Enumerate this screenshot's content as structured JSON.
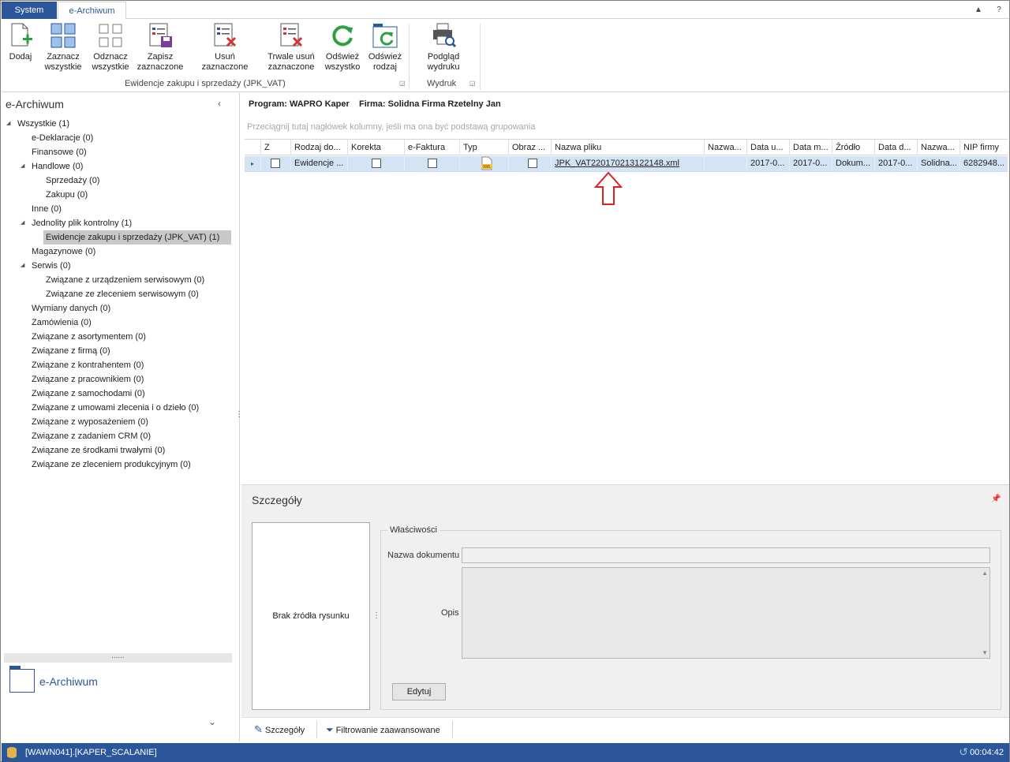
{
  "tabs": {
    "system": "System",
    "earchiwum": "e-Archiwum"
  },
  "ribbon": {
    "buttons": [
      {
        "label": "Dodaj"
      },
      {
        "label": "Zaznacz\nwszystkie"
      },
      {
        "label": "Odznacz\nwszystkie"
      },
      {
        "label": "Zapisz\nzaznaczone"
      },
      {
        "label": "Usuń zaznaczone"
      },
      {
        "label": "Trwale usuń\nzaznaczone"
      },
      {
        "label": "Odśwież\nwszystko"
      },
      {
        "label": "Odśwież\nrodzaj"
      },
      {
        "label": "Podgląd\nwydruku"
      }
    ],
    "group1": "Ewidencje zakupu i sprzedaży (JPK_VAT)",
    "group2": "Wydruk"
  },
  "left": {
    "title": "e-Archiwum",
    "tree": [
      "Wszystkie (1)",
      "e-Deklaracje (0)",
      "Finansowe (0)",
      "Handlowe (0)",
      "Sprzedaży (0)",
      "Zakupu (0)",
      "Inne (0)",
      "Jednolity plik kontrolny (1)",
      "Ewidencje zakupu i sprzedaży (JPK_VAT) (1)",
      "Magazynowe (0)",
      "Serwis (0)",
      "Związane z urządzeniem serwisowym (0)",
      "Związane ze zleceniem serwisowym (0)",
      "Wymiany danych (0)",
      "Zamówienia (0)",
      "Związane z asortymentem (0)",
      "Związane z firmą (0)",
      "Związane z kontrahentem (0)",
      "Związane z pracownikiem (0)",
      "Związane z samochodami (0)",
      "Związane z umowami zlecenia i o dzieło (0)",
      "Związane z wyposażeniem (0)",
      "Związane z zadaniem CRM (0)",
      "Związane ze środkami trwałymi (0)",
      "Związane ze zleceniem produkcyjnym (0)"
    ],
    "divider": "......",
    "nav_label": "e-Archiwum"
  },
  "main": {
    "program_line": "Program: WAPRO Kaper    Firma: Solidna Firma Rzetelny Jan",
    "group_hint": "Przeciągnij tutaj nagłówek kolumny, jeśli ma ona być podstawą grupowania",
    "columns": [
      "Z",
      "Rodzaj do...",
      "Korekta",
      "e-Faktura",
      "Typ",
      "Obraz ...",
      "Nazwa pliku",
      "Nazwa...",
      "Data u...",
      "Data m...",
      "Źródło",
      "Data d...",
      "Nazwa...",
      "NIP firmy"
    ],
    "row": {
      "rodzaj": "Ewidencje ...",
      "typ_icon": "XML",
      "nazwa_pliku": "JPK_VAT220170213122148.xml",
      "data_u": "2017-0...",
      "data_m": "2017-0...",
      "zrodlo": "Dokum...",
      "data_d": "2017-0...",
      "nazwa2": "Solidna...",
      "nip": "6282948..."
    }
  },
  "details": {
    "title": "Szczegóły",
    "no_image": "Brak źródła rysunku",
    "props_legend": "Właściwości",
    "name_label": "Nazwa dokumentu",
    "opis_label": "Opis",
    "edit_button": "Edytuj"
  },
  "bottom_tabs": {
    "details": "Szczegóły",
    "filter": "Filtrowanie zaawansowane"
  },
  "status": {
    "db": "[WAWN041].[KAPER_SCALANIE]",
    "time": "00:04:42"
  },
  "colors": {
    "accent": "#2b579a",
    "row_selected": "#d4e4f5",
    "arrow": "#e02020"
  }
}
